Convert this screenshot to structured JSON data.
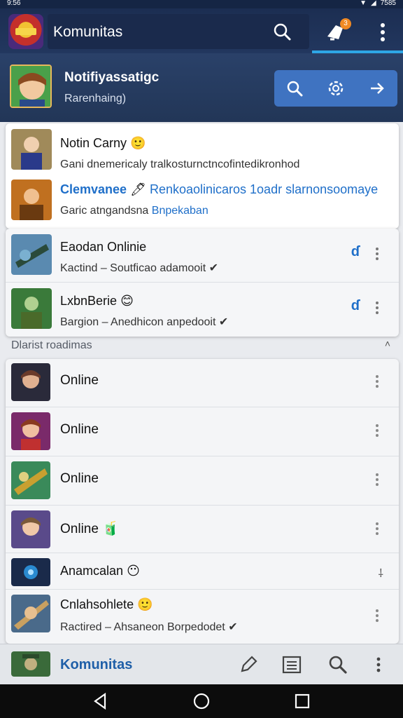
{
  "status_bar": {
    "time": "9:56",
    "battery_text": "7585"
  },
  "app_bar": {
    "title": "Komunitas",
    "notification_count": "3",
    "icons": [
      "app-logo",
      "search-icon",
      "notification-icon",
      "more-vert-icon"
    ]
  },
  "profile": {
    "name": "Notifiyassatigc",
    "status": "Rarenhaing)",
    "actions": [
      "search-icon",
      "settings-icon",
      "arrow-right-icon"
    ]
  },
  "notifications": [
    {
      "title": "Notin Carny",
      "emoji": "🙂",
      "text": "Gani dnemericaly tralkosturnctncofintedikronhod"
    },
    {
      "title": "Clemvanee",
      "emoji": "🖊",
      "title_link": "Renkoaolinicaros 1oadr slarnonsoomaye",
      "text": "Garic atngandsna",
      "text_link": "Bnpekaban"
    }
  ],
  "contacts": [
    {
      "name": "Eaodan Onlinie",
      "subtitle": "Kactind – Soutficao adamooit",
      "action": "ɗ"
    },
    {
      "name": "LxbnBerie",
      "emoji": "😊",
      "subtitle": "Bargion – Anedhicon anpedooit",
      "action": "ɗ"
    }
  ],
  "section": {
    "title": "Dlarist roadimas"
  },
  "list": [
    {
      "name": "Online",
      "emoji": ""
    },
    {
      "name": "Online",
      "emoji": ""
    },
    {
      "name": "Online",
      "emoji": ""
    },
    {
      "name": "Online",
      "emoji": "🧃"
    },
    {
      "name": "Anamcalan",
      "emoji": "😶"
    },
    {
      "name": "Cnlahsohlete",
      "emoji": "🙂",
      "subtitle": "Ractired – Ahsaneon Borpedodet"
    }
  ],
  "bottom_bar": {
    "label": "Komunitas",
    "icons": [
      "edit-icon",
      "list-icon",
      "search-icon",
      "more-vert-icon"
    ]
  },
  "colors": {
    "accent": "#2ea6e6",
    "primary": "#1c2e52",
    "action_blue": "#3f73c1",
    "link": "#1f6fc9"
  }
}
